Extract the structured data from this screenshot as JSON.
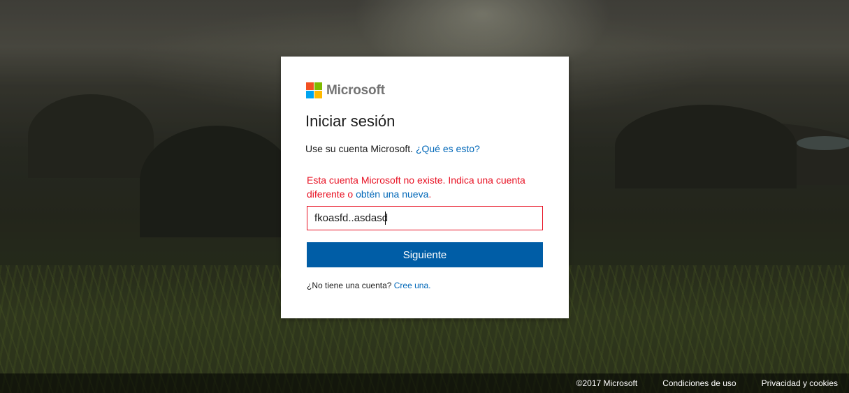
{
  "brand": {
    "name": "Microsoft",
    "logo_colors": [
      "#f25022",
      "#7fba00",
      "#00a4ef",
      "#ffb900"
    ]
  },
  "signin": {
    "title": "Iniciar sesión",
    "subtitle": "Use su cuenta Microsoft.",
    "whats_this_link": "¿Qué es esto?",
    "error_text": "Esta cuenta Microsoft no existe. Indica una cuenta diferente o",
    "error_link": "obtén una nueva",
    "error_suffix": ".",
    "account_input_value": "fkoasfd..asdasd",
    "next_button": "Siguiente",
    "no_account_text": "¿No tiene una cuenta?",
    "create_link": "Cree una."
  },
  "footer": {
    "copyright": "©2017 Microsoft",
    "terms_link": "Condiciones de uso",
    "privacy_link": "Privacidad y cookies"
  },
  "colors": {
    "accent": "#0067b8",
    "button": "#005da6",
    "error": "#e81123"
  }
}
